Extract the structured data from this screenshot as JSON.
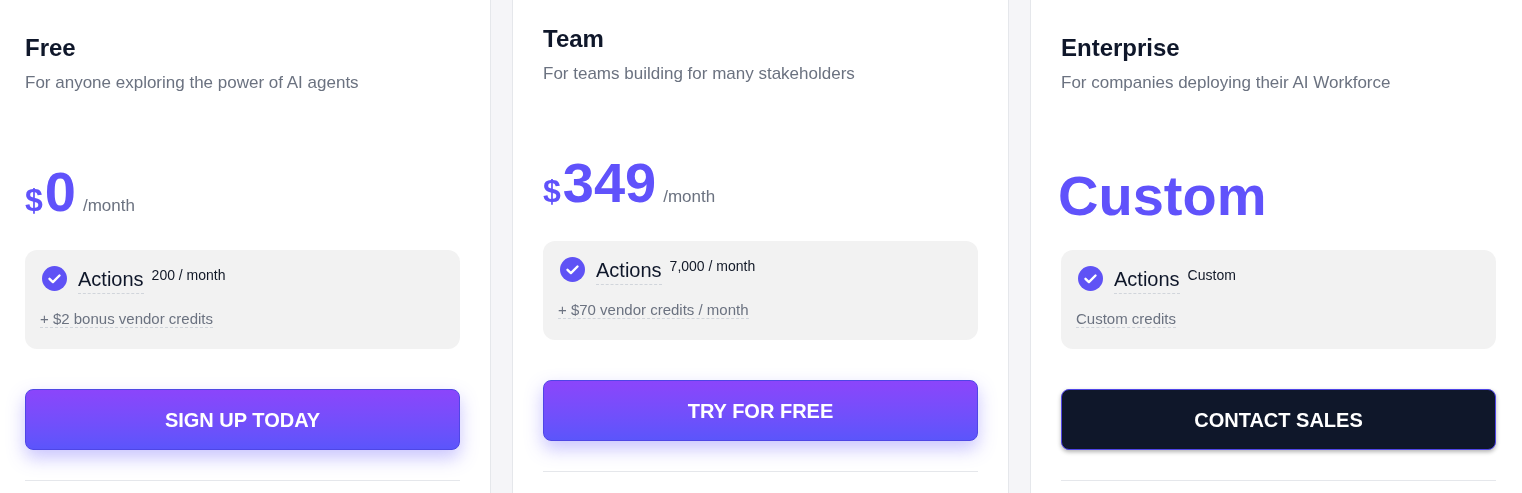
{
  "plans": [
    {
      "name": "Free",
      "description": "For anyone exploring the power of AI agents",
      "featured": false,
      "price": {
        "kind": "amount",
        "currency": "$",
        "amount": "0",
        "period": "/month"
      },
      "feature": {
        "label": "Actions",
        "value": "200 / month"
      },
      "credits": "+ $2 bonus vendor credits",
      "button": {
        "label": "SIGN UP TODAY",
        "kind": "primary"
      }
    },
    {
      "name": "Team",
      "description": "For teams building for many stakeholders",
      "featured": true,
      "price": {
        "kind": "amount",
        "currency": "$",
        "amount": "349",
        "period": "/month"
      },
      "feature": {
        "label": "Actions",
        "value": "7,000 / month"
      },
      "credits": "+ $70 vendor credits / month",
      "button": {
        "label": "TRY FOR FREE",
        "kind": "primary"
      }
    },
    {
      "name": "Enterprise",
      "description": "For companies deploying their AI Workforce",
      "featured": false,
      "price": {
        "kind": "custom",
        "amount": "Custom"
      },
      "feature": {
        "label": "Actions",
        "value": "Custom"
      },
      "credits": "Custom credits",
      "button": {
        "label": "CONTACT SALES",
        "kind": "dark"
      }
    }
  ]
}
